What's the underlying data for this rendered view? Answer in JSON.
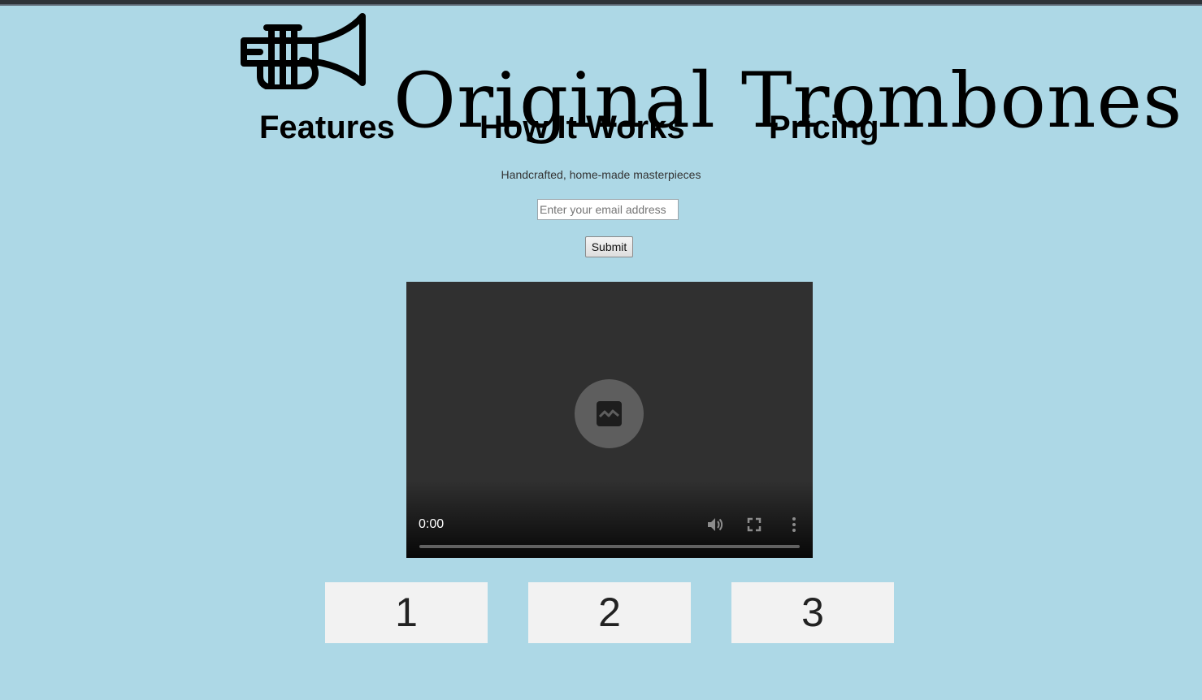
{
  "header": {
    "title": "Original Trombones",
    "logo_icon": "trumpet-icon"
  },
  "nav": {
    "items": [
      {
        "label": "Features"
      },
      {
        "label": "How It Works"
      },
      {
        "label": "Pricing"
      }
    ]
  },
  "form": {
    "tagline": "Handcrafted, home-made masterpieces",
    "email_placeholder": "Enter your email address",
    "email_value": "",
    "submit_label": "Submit"
  },
  "video": {
    "time": "0:00",
    "progress": 0,
    "center_icon": "broken-image-icon",
    "controls": [
      "volume-icon",
      "fullscreen-icon",
      "more-options-icon"
    ]
  },
  "boxes": [
    "1",
    "2",
    "3"
  ],
  "colors": {
    "background": "#add8e6",
    "video_bg": "#303030",
    "box_bg": "#f2f2f2"
  }
}
